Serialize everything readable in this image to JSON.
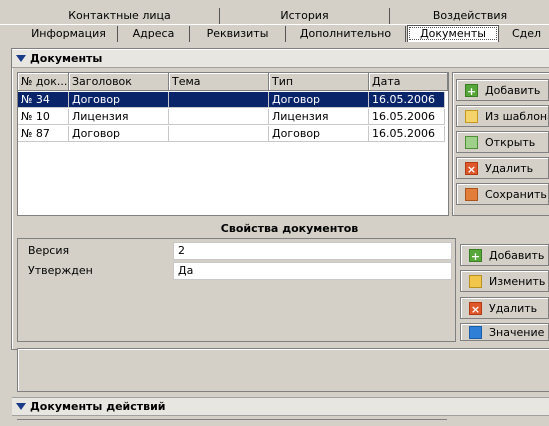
{
  "tabs_row1": [
    "Контактные лица",
    "История",
    "Воздействия"
  ],
  "tabs_row2": [
    "Информация",
    "Адреса",
    "Реквизиты",
    "Дополнительно",
    "Документы",
    "Сдел"
  ],
  "documents": {
    "title": "Документы",
    "columns": [
      "№ док...",
      "Заголовок",
      "Тема",
      "Тип",
      "Дата"
    ],
    "rows": [
      {
        "num": "№ 34",
        "title": "Договор",
        "topic": "",
        "type": "Договор",
        "date": "16.05.2006",
        "selected": true
      },
      {
        "num": "№ 10",
        "title": "Лицензия",
        "topic": "",
        "type": "Лицензия",
        "date": "16.05.2006",
        "selected": false
      },
      {
        "num": "№ 87",
        "title": "Договор",
        "topic": "",
        "type": "Договор",
        "date": "16.05.2006",
        "selected": false
      }
    ],
    "buttons": {
      "add": "Добавить",
      "from_template": "Из шаблона",
      "open": "Открыть",
      "delete": "Удалить",
      "save": "Сохранить"
    }
  },
  "properties": {
    "title": "Свойства документов",
    "rows": [
      {
        "label": "Версия",
        "value": "2"
      },
      {
        "label": "Утвержден",
        "value": "Да"
      }
    ],
    "buttons": {
      "add": "Добавить",
      "edit": "Изменить",
      "delete": "Удалить",
      "value": "Значение"
    }
  },
  "actions": {
    "title": "Документы действий"
  },
  "icons": [
    "add-icon",
    "template-icon",
    "folder-open-icon",
    "delete-icon",
    "save-icon",
    "edit-icon",
    "list-icon",
    "collapse-triangle-icon"
  ],
  "colors": {
    "selection": "#0a246a",
    "panel": "#d4d0c8",
    "accent_triangle": "#1a3a8a"
  }
}
